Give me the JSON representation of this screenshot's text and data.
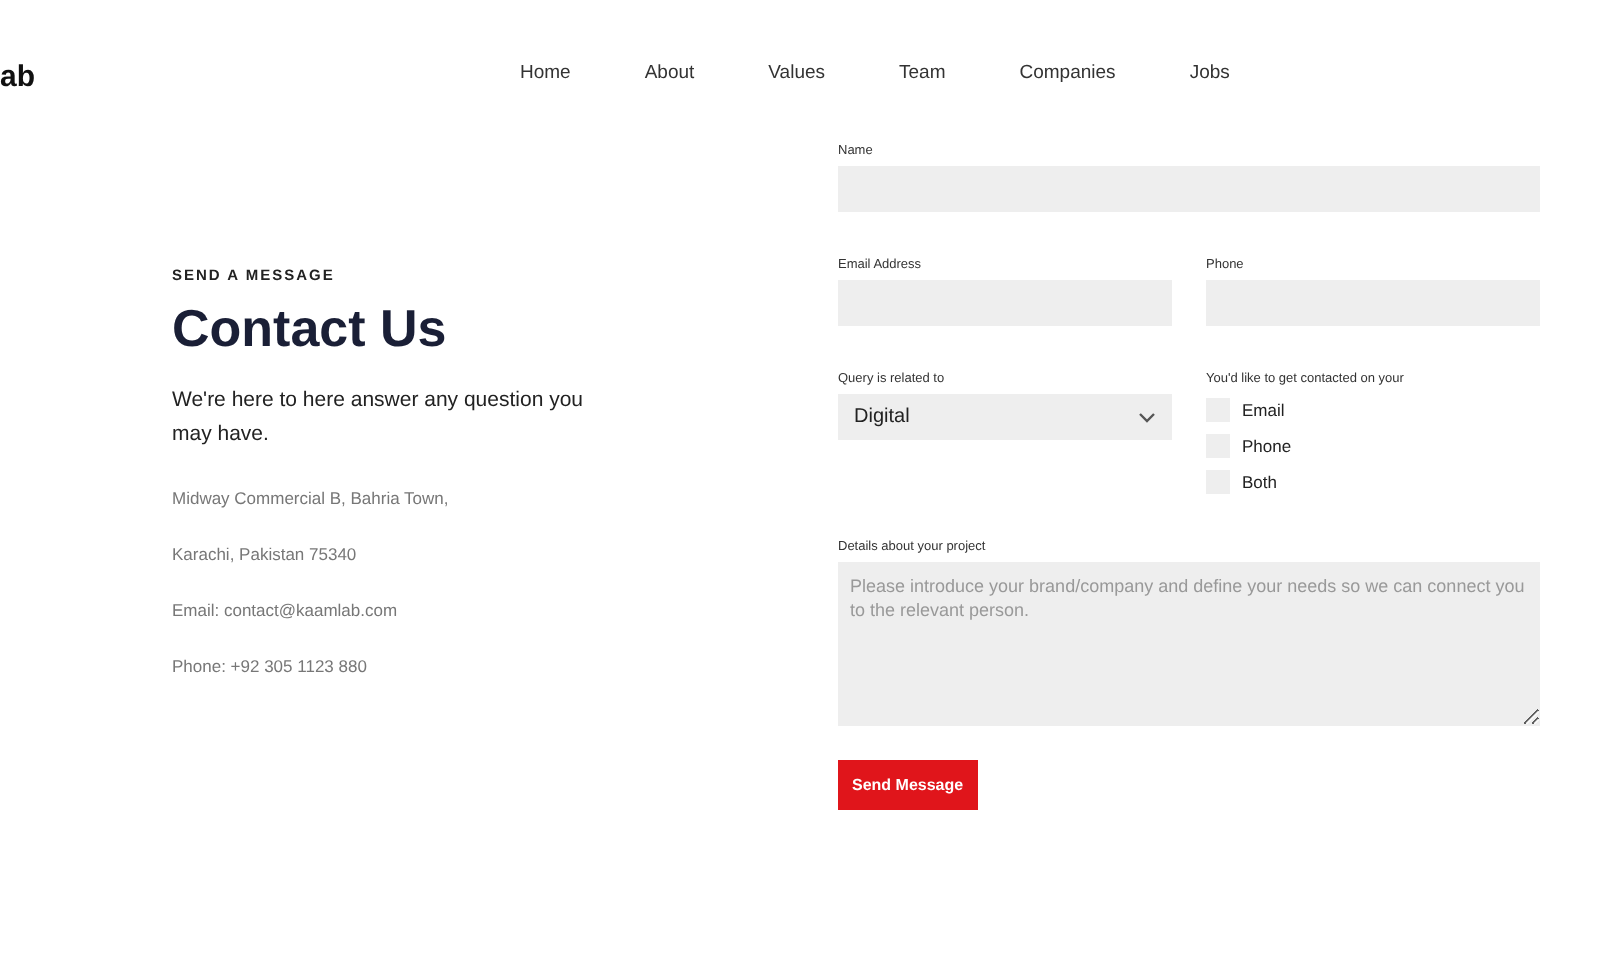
{
  "logo": {
    "text": "ab"
  },
  "nav": [
    {
      "label": "Home"
    },
    {
      "label": "About"
    },
    {
      "label": "Values"
    },
    {
      "label": "Team"
    },
    {
      "label": "Companies"
    },
    {
      "label": "Jobs"
    }
  ],
  "intro": {
    "eyebrow": "SEND A MESSAGE",
    "title": "Contact Us",
    "lead": "We're here to here answer any question you may have.",
    "address_line_1": "Midway Commercial B, Bahria Town,",
    "address_line_2": "Karachi, Pakistan 75340",
    "email": "Email: contact@kaamlab.com",
    "phone": "Phone: +92 305 1123 880"
  },
  "form": {
    "name_label": "Name",
    "email_label": "Email Address",
    "phone_label": "Phone",
    "query_label": "Query is related to",
    "query_value": "Digital",
    "contact_label": "You'd like to get contacted on your",
    "contact_options": [
      {
        "label": "Email",
        "checked": false
      },
      {
        "label": "Phone",
        "checked": false
      },
      {
        "label": "Both",
        "checked": false
      }
    ],
    "details_label": "Details about your project",
    "details_placeholder": "Please introduce your brand/company and define your needs so we can connect you to the relevant person.",
    "submit": "Send Message"
  }
}
